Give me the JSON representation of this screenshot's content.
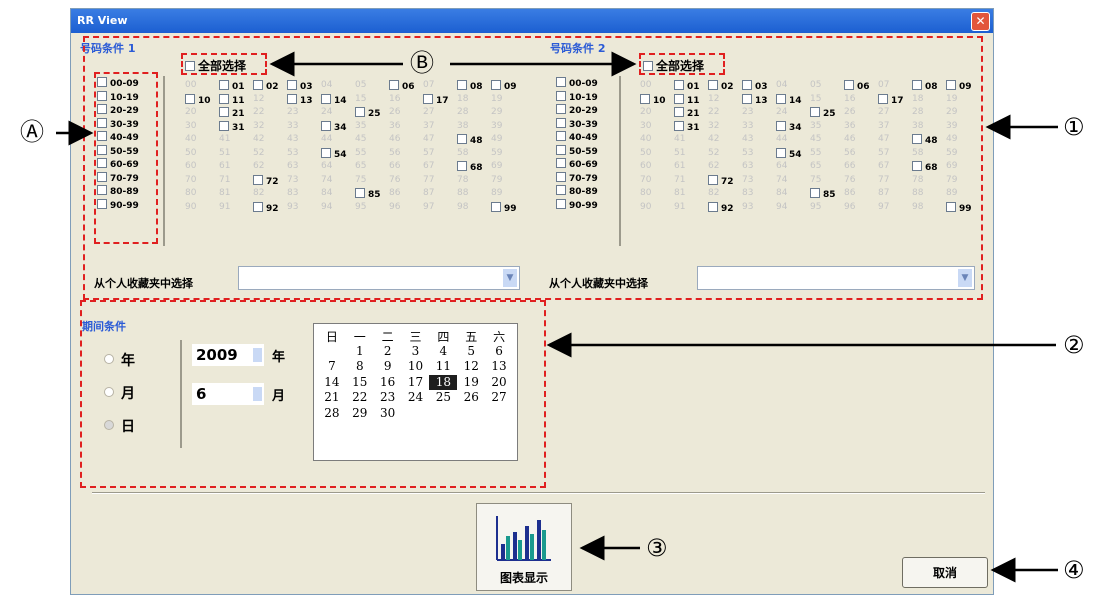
{
  "window": {
    "title": "RR View",
    "close_glyph": "✕"
  },
  "number_sections": [
    {
      "label": "号码条件 1",
      "select_all": "全部选择",
      "groups": [
        "00-09",
        "10-19",
        "20-29",
        "30-39",
        "40-49",
        "50-59",
        "60-69",
        "70-79",
        "80-89",
        "90-99"
      ],
      "favorites_label": "从个人收藏夹中选择",
      "favorites_value": "",
      "rows": [
        [
          [
            "00",
            0
          ],
          [
            "01",
            1
          ],
          [
            "02",
            1
          ],
          [
            "03",
            1
          ],
          [
            "04",
            0
          ],
          [
            "05",
            0
          ],
          [
            "06",
            1
          ],
          [
            "07",
            0
          ],
          [
            "08",
            1
          ],
          [
            "09",
            1
          ]
        ],
        [
          [
            "10",
            1
          ],
          [
            "11",
            1
          ],
          [
            "12",
            0
          ],
          [
            "13",
            1
          ],
          [
            "14",
            1
          ],
          [
            "15",
            0
          ],
          [
            "16",
            0
          ],
          [
            "17",
            1
          ],
          [
            "18",
            0
          ],
          [
            "19",
            0
          ]
        ],
        [
          [
            "20",
            0
          ],
          [
            "21",
            1
          ],
          [
            "22",
            0
          ],
          [
            "23",
            0
          ],
          [
            "24",
            0
          ],
          [
            "25",
            1
          ],
          [
            "26",
            0
          ],
          [
            "27",
            0
          ],
          [
            "28",
            0
          ],
          [
            "29",
            0
          ]
        ],
        [
          [
            "30",
            0
          ],
          [
            "31",
            1
          ],
          [
            "32",
            0
          ],
          [
            "33",
            0
          ],
          [
            "34",
            1
          ],
          [
            "35",
            0
          ],
          [
            "36",
            0
          ],
          [
            "37",
            0
          ],
          [
            "38",
            0
          ],
          [
            "39",
            0
          ]
        ],
        [
          [
            "40",
            0
          ],
          [
            "41",
            0
          ],
          [
            "42",
            0
          ],
          [
            "43",
            0
          ],
          [
            "44",
            0
          ],
          [
            "45",
            0
          ],
          [
            "46",
            0
          ],
          [
            "47",
            0
          ],
          [
            "48",
            1
          ],
          [
            "49",
            0
          ]
        ],
        [
          [
            "50",
            0
          ],
          [
            "51",
            0
          ],
          [
            "52",
            0
          ],
          [
            "53",
            0
          ],
          [
            "54",
            1
          ],
          [
            "55",
            0
          ],
          [
            "56",
            0
          ],
          [
            "57",
            0
          ],
          [
            "58",
            0
          ],
          [
            "59",
            0
          ]
        ],
        [
          [
            "60",
            0
          ],
          [
            "61",
            0
          ],
          [
            "62",
            0
          ],
          [
            "63",
            0
          ],
          [
            "64",
            0
          ],
          [
            "65",
            0
          ],
          [
            "66",
            0
          ],
          [
            "67",
            0
          ],
          [
            "68",
            1
          ],
          [
            "69",
            0
          ]
        ],
        [
          [
            "70",
            0
          ],
          [
            "71",
            0
          ],
          [
            "72",
            1
          ],
          [
            "73",
            0
          ],
          [
            "74",
            0
          ],
          [
            "75",
            0
          ],
          [
            "76",
            0
          ],
          [
            "77",
            0
          ],
          [
            "78",
            0
          ],
          [
            "79",
            0
          ]
        ],
        [
          [
            "80",
            0
          ],
          [
            "81",
            0
          ],
          [
            "82",
            0
          ],
          [
            "83",
            0
          ],
          [
            "84",
            0
          ],
          [
            "85",
            1
          ],
          [
            "86",
            0
          ],
          [
            "87",
            0
          ],
          [
            "88",
            0
          ],
          [
            "89",
            0
          ]
        ],
        [
          [
            "90",
            0
          ],
          [
            "91",
            0
          ],
          [
            "92",
            1
          ],
          [
            "93",
            0
          ],
          [
            "94",
            0
          ],
          [
            "95",
            0
          ],
          [
            "96",
            0
          ],
          [
            "97",
            0
          ],
          [
            "98",
            0
          ],
          [
            "99",
            1
          ]
        ]
      ]
    },
    {
      "label": "号码条件 2",
      "select_all": "全部选择",
      "groups": [
        "00-09",
        "10-19",
        "20-29",
        "30-39",
        "40-49",
        "50-59",
        "60-69",
        "70-79",
        "80-89",
        "90-99"
      ],
      "favorites_label": "从个人收藏夹中选择",
      "favorites_value": "",
      "rows": [
        [
          [
            "00",
            0
          ],
          [
            "01",
            1
          ],
          [
            "02",
            1
          ],
          [
            "03",
            1
          ],
          [
            "04",
            0
          ],
          [
            "05",
            0
          ],
          [
            "06",
            1
          ],
          [
            "07",
            0
          ],
          [
            "08",
            1
          ],
          [
            "09",
            1
          ]
        ],
        [
          [
            "10",
            1
          ],
          [
            "11",
            1
          ],
          [
            "12",
            0
          ],
          [
            "13",
            1
          ],
          [
            "14",
            1
          ],
          [
            "15",
            0
          ],
          [
            "16",
            0
          ],
          [
            "17",
            1
          ],
          [
            "18",
            0
          ],
          [
            "19",
            0
          ]
        ],
        [
          [
            "20",
            0
          ],
          [
            "21",
            1
          ],
          [
            "22",
            0
          ],
          [
            "23",
            0
          ],
          [
            "24",
            0
          ],
          [
            "25",
            1
          ],
          [
            "26",
            0
          ],
          [
            "27",
            0
          ],
          [
            "28",
            0
          ],
          [
            "29",
            0
          ]
        ],
        [
          [
            "30",
            0
          ],
          [
            "31",
            1
          ],
          [
            "32",
            0
          ],
          [
            "33",
            0
          ],
          [
            "34",
            1
          ],
          [
            "35",
            0
          ],
          [
            "36",
            0
          ],
          [
            "37",
            0
          ],
          [
            "38",
            0
          ],
          [
            "39",
            0
          ]
        ],
        [
          [
            "40",
            0
          ],
          [
            "41",
            0
          ],
          [
            "42",
            0
          ],
          [
            "43",
            0
          ],
          [
            "44",
            0
          ],
          [
            "45",
            0
          ],
          [
            "46",
            0
          ],
          [
            "47",
            0
          ],
          [
            "48",
            1
          ],
          [
            "49",
            0
          ]
        ],
        [
          [
            "50",
            0
          ],
          [
            "51",
            0
          ],
          [
            "52",
            0
          ],
          [
            "53",
            0
          ],
          [
            "54",
            1
          ],
          [
            "55",
            0
          ],
          [
            "56",
            0
          ],
          [
            "57",
            0
          ],
          [
            "58",
            0
          ],
          [
            "59",
            0
          ]
        ],
        [
          [
            "60",
            0
          ],
          [
            "61",
            0
          ],
          [
            "62",
            0
          ],
          [
            "63",
            0
          ],
          [
            "64",
            0
          ],
          [
            "65",
            0
          ],
          [
            "66",
            0
          ],
          [
            "67",
            0
          ],
          [
            "68",
            1
          ],
          [
            "69",
            0
          ]
        ],
        [
          [
            "70",
            0
          ],
          [
            "71",
            0
          ],
          [
            "72",
            1
          ],
          [
            "73",
            0
          ],
          [
            "74",
            0
          ],
          [
            "75",
            0
          ],
          [
            "76",
            0
          ],
          [
            "77",
            0
          ],
          [
            "78",
            0
          ],
          [
            "79",
            0
          ]
        ],
        [
          [
            "80",
            0
          ],
          [
            "81",
            0
          ],
          [
            "82",
            0
          ],
          [
            "83",
            0
          ],
          [
            "84",
            0
          ],
          [
            "85",
            1
          ],
          [
            "86",
            0
          ],
          [
            "87",
            0
          ],
          [
            "88",
            0
          ],
          [
            "89",
            0
          ]
        ],
        [
          [
            "90",
            0
          ],
          [
            "91",
            0
          ],
          [
            "92",
            1
          ],
          [
            "93",
            0
          ],
          [
            "94",
            0
          ],
          [
            "95",
            0
          ],
          [
            "96",
            0
          ],
          [
            "97",
            0
          ],
          [
            "98",
            0
          ],
          [
            "99",
            1
          ]
        ]
      ]
    }
  ],
  "period": {
    "label": "期间条件",
    "radios": [
      "年",
      "月",
      "日"
    ],
    "selected_radio": "日",
    "year_value": "2009",
    "year_unit": "年",
    "month_value": "6",
    "month_unit": "月",
    "calendar": {
      "weekdays": [
        "日",
        "一",
        "二",
        "三",
        "四",
        "五",
        "六"
      ],
      "leading_blanks": 1,
      "days": [
        "1",
        "2",
        "3",
        "4",
        "5",
        "6",
        "7",
        "8",
        "9",
        "10",
        "11",
        "12",
        "13",
        "14",
        "15",
        "16",
        "17",
        "18",
        "19",
        "20",
        "21",
        "22",
        "23",
        "24",
        "25",
        "26",
        "27",
        "28",
        "29",
        "30"
      ],
      "selected_day": "18"
    }
  },
  "buttons": {
    "chart": "图表显示",
    "cancel": "取消"
  },
  "annotations": {
    "A": "Ⓐ",
    "B": "Ⓑ",
    "one": "①",
    "two": "②",
    "three": "③",
    "four": "④"
  },
  "colors": {
    "annotation_red": "#e02020",
    "titlebar": "#1c5fd1",
    "panel_bg": "#ece9d8",
    "chart_teal": "#1a9a8e",
    "chart_navy": "#1d2f8f"
  }
}
